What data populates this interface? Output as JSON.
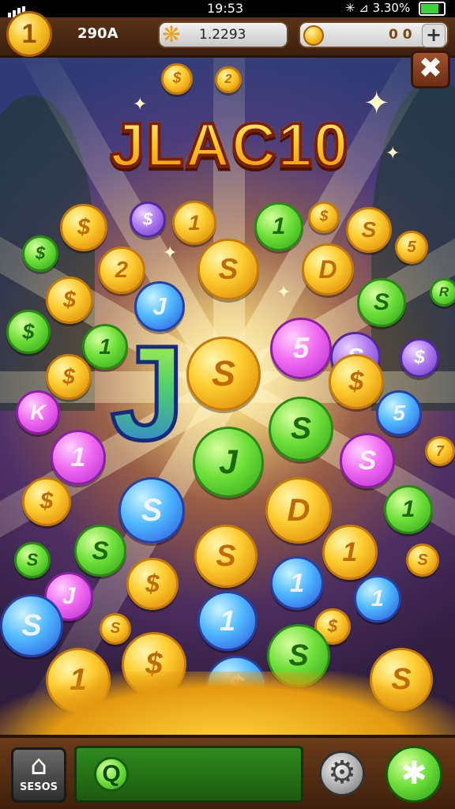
{
  "status_bar": {
    "time": "19:53",
    "indicators": "✳ ⊿ 3.30%"
  },
  "hud": {
    "main_coin_symbol": "1",
    "coin_count": "290A",
    "gem_value": "1.2293",
    "bar_value": "0 0",
    "plus_label": "+"
  },
  "close_label": "✖",
  "title": "JLAC10",
  "coins": [
    {
      "label": "$",
      "color": "gold"
    },
    {
      "label": "2",
      "color": "gold"
    },
    {
      "label": "$",
      "color": "gold"
    },
    {
      "label": "$",
      "color": "purple"
    },
    {
      "label": "1",
      "color": "gold"
    },
    {
      "label": "1",
      "color": "green"
    },
    {
      "label": "$",
      "color": "gold"
    },
    {
      "label": "S",
      "color": "gold"
    },
    {
      "label": "$",
      "color": "green"
    },
    {
      "label": "5",
      "color": "gold"
    },
    {
      "label": "2",
      "color": "gold"
    },
    {
      "label": "S",
      "color": "gold"
    },
    {
      "label": "D",
      "color": "gold"
    },
    {
      "label": "$",
      "color": "gold"
    },
    {
      "label": "J",
      "color": "blue"
    },
    {
      "label": "S",
      "color": "green"
    },
    {
      "label": "R",
      "color": "green"
    },
    {
      "label": "$",
      "color": "green"
    },
    {
      "label": "S",
      "color": "gold"
    },
    {
      "label": "5",
      "color": "pink"
    },
    {
      "label": "1",
      "color": "green"
    },
    {
      "label": "S",
      "color": "purple"
    },
    {
      "label": "$",
      "color": "purple"
    },
    {
      "label": "$",
      "color": "gold"
    },
    {
      "label": "$",
      "color": "gold"
    },
    {
      "label": "5",
      "color": "blue"
    },
    {
      "label": "K",
      "color": "pink"
    },
    {
      "label": "S",
      "color": "green"
    },
    {
      "label": "J",
      "color": "green"
    },
    {
      "label": "1",
      "color": "pink"
    },
    {
      "label": "S",
      "color": "pink"
    },
    {
      "label": "7",
      "color": "gold"
    },
    {
      "label": "$",
      "color": "gold"
    },
    {
      "label": "S",
      "color": "blue"
    },
    {
      "label": "D",
      "color": "gold"
    },
    {
      "label": "1",
      "color": "green"
    },
    {
      "label": "S",
      "color": "green"
    },
    {
      "label": "S",
      "color": "green"
    },
    {
      "label": "S",
      "color": "gold"
    },
    {
      "label": "1",
      "color": "gold"
    },
    {
      "label": "S",
      "color": "gold"
    },
    {
      "label": "$",
      "color": "gold"
    },
    {
      "label": "1",
      "color": "blue"
    },
    {
      "label": "J",
      "color": "pink"
    },
    {
      "label": "1",
      "color": "blue"
    },
    {
      "label": "S",
      "color": "gold"
    },
    {
      "label": "1",
      "color": "blue"
    },
    {
      "label": "$",
      "color": "gold"
    },
    {
      "label": "S",
      "color": "blue"
    },
    {
      "label": "S",
      "color": "green"
    },
    {
      "label": "$",
      "color": "gold"
    },
    {
      "label": "1",
      "color": "gold"
    },
    {
      "label": "$",
      "color": "blue"
    },
    {
      "label": "S",
      "color": "gold"
    }
  ],
  "center_letter": "J",
  "bottom": {
    "home_label": "SESOS",
    "home_icon": "home-icon",
    "search_symbol": "Q",
    "gear_icon": "gear-icon",
    "action_icon": "sparkle-icon"
  },
  "colors": {
    "gold": "#ffcf33",
    "green": "#6fe03a",
    "blue": "#4fb8ff",
    "pink": "#f06af0",
    "purple": "#b07cf0",
    "wood": "#5a3318"
  }
}
